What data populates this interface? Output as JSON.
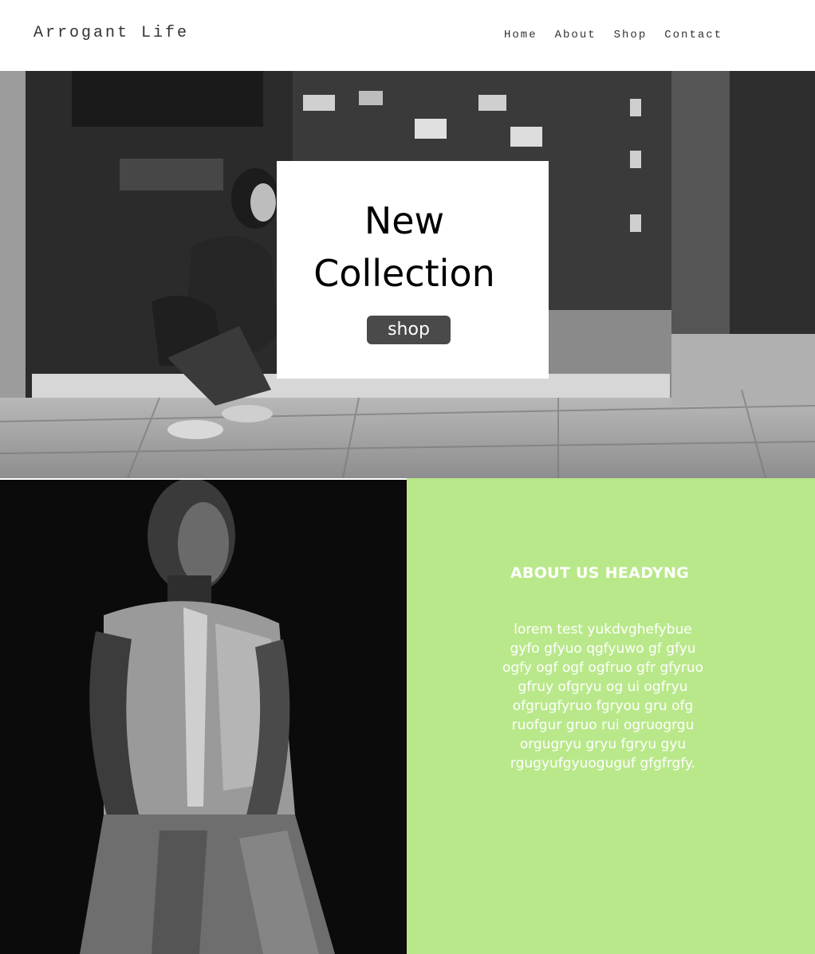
{
  "header": {
    "logo": "Arrogant Life",
    "nav": [
      "Home",
      "About",
      "Shop",
      "Contact"
    ]
  },
  "hero": {
    "title": "New Collection",
    "button_label": "shop"
  },
  "about": {
    "heading": "ABOUT US HEADYNG",
    "body": "lorem test yukdvghefybue\ngyfo gfyuo qgfyuwo gf gfyu\nogfy ogf ogf  ogfruo gfr gfyruo\ngfruy ofgryu og ui ogfryu\nofgrugfyruo fgryou gru ofg\nruofgur gruo rui ogruogrgu\norgugryu gryu fgryu gyu\nrgugyufgyuoguguf gfgfrgfy."
  },
  "colors": {
    "about_bg": "#b9e88a",
    "button_bg": "#4a4a4a",
    "header_bg": "#ffffff"
  }
}
